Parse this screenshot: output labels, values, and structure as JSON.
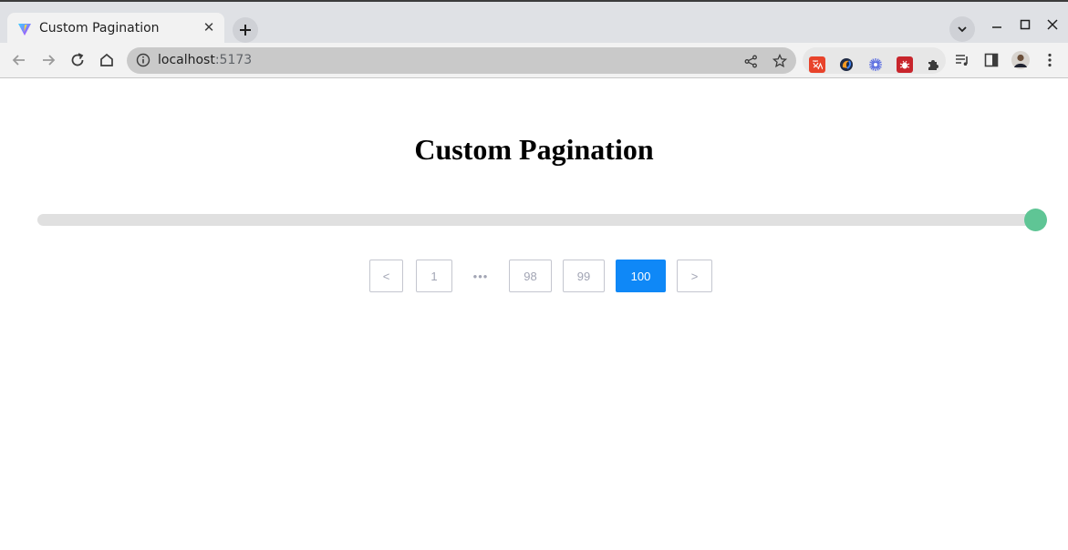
{
  "browser": {
    "tab": {
      "title": "Custom Pagination",
      "close": "✕"
    },
    "new_tab": "+",
    "address": {
      "host": "localhost",
      "port": ":5173"
    }
  },
  "page": {
    "title": "Custom Pagination",
    "slider": {
      "min": 1,
      "max": 100,
      "value": 100,
      "fill_color": "#5fc595",
      "track_color": "#e0e0e0"
    },
    "pagination": {
      "prev": "<",
      "next": ">",
      "items": [
        {
          "label": "1",
          "active": false
        },
        {
          "label": "•••",
          "ellipsis": true
        },
        {
          "label": "98",
          "active": false
        },
        {
          "label": "99",
          "active": false
        },
        {
          "label": "100",
          "active": true
        }
      ],
      "accent": "#0f88f7"
    }
  }
}
